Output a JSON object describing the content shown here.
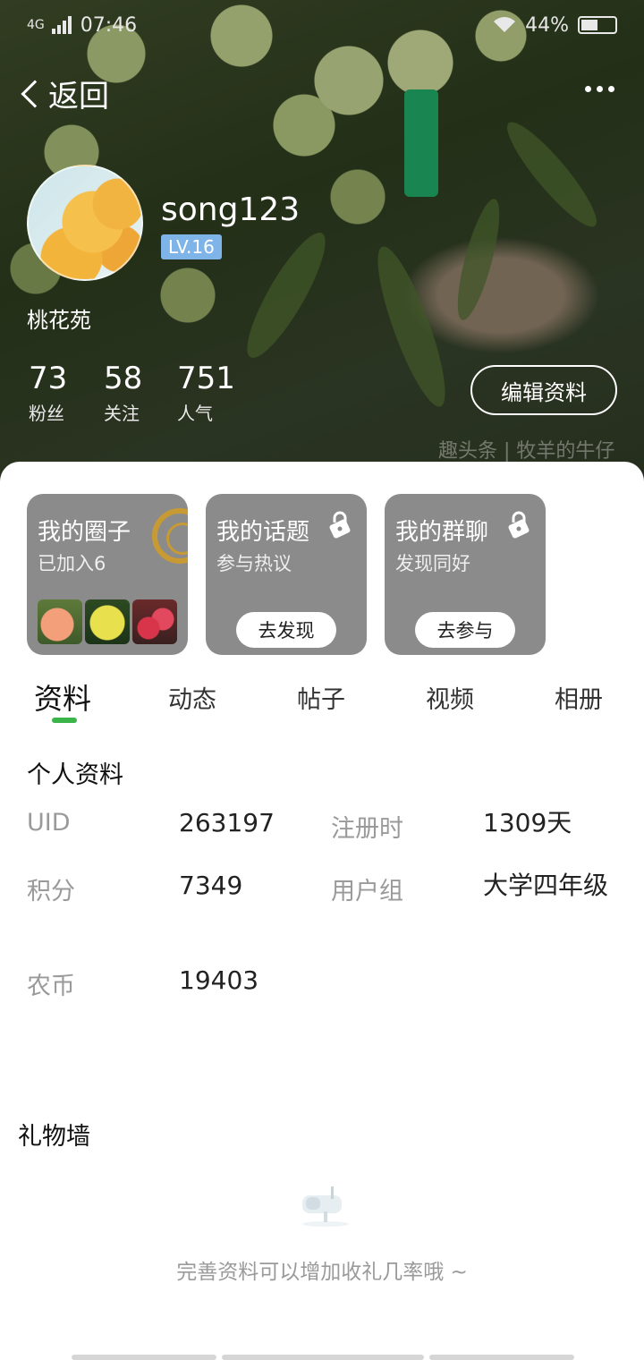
{
  "status_bar": {
    "network": "4G",
    "time": "07:46",
    "battery": "44%",
    "battery_level": 0.44
  },
  "header": {
    "back_label": "返回",
    "username": "song123",
    "level": "LV.16",
    "location": "桃花苑",
    "stats": [
      {
        "value": "73",
        "label": "粉丝"
      },
      {
        "value": "58",
        "label": "关注"
      },
      {
        "value": "751",
        "label": "人气"
      }
    ],
    "edit_label": "编辑资料",
    "watermark": "趣头条 | 牧羊的牛仔"
  },
  "cards": [
    {
      "title": "我的圈子",
      "subtitle": "已加入6"
    },
    {
      "title": "我的话题",
      "subtitle": "参与热议",
      "button": "去发现"
    },
    {
      "title": "我的群聊",
      "subtitle": "发现同好",
      "button": "去参与"
    }
  ],
  "tabs": [
    "资料",
    "动态",
    "帖子",
    "视频",
    "相册"
  ],
  "profile": {
    "title": "个人资料",
    "fields": [
      {
        "label": "UID",
        "value": "263197"
      },
      {
        "label": "注册时",
        "value": "1309天"
      },
      {
        "label": "积分",
        "value": "7349"
      },
      {
        "label": "用户组",
        "value": "大学四年级"
      },
      {
        "label": "农币",
        "value": "19403"
      }
    ]
  },
  "gift_wall": {
    "title": "礼物墙",
    "empty_text": "完善资料可以增加收礼几率哦 ~"
  },
  "colors": {
    "accent_green": "#3bb54a",
    "level_blue": "#7fb4e8",
    "card_gray": "#8b8b8b"
  },
  "icons": [
    "back-chevron-icon",
    "more-icon",
    "lock-icon",
    "mailbox-icon",
    "wifi-icon",
    "signal-icon",
    "battery-icon"
  ]
}
